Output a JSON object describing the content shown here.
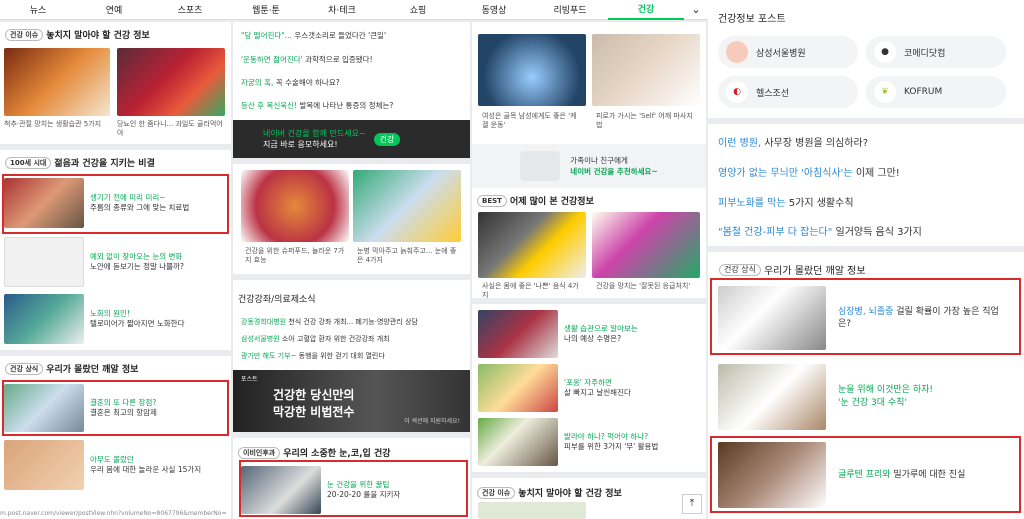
{
  "nav": [
    "뉴스",
    "연예",
    "스포츠",
    "웹툰·툰",
    "차·테크",
    "쇼핑",
    "동영상",
    "리빙푸드",
    "건강"
  ],
  "col1": {
    "s1_badge": "건강 이슈",
    "s1_title": "놓치지 말아야 할 건강 정보",
    "s1_caps": [
      "척추·관절 망치는 생활습관 5가지",
      "당뇨인 한 줌다니... 과일도 골라먹어야"
    ],
    "s2_badge": "100세 시대",
    "s2_title": "젊음과 건강을 지키는 비결",
    "s2_items": [
      {
        "l1": "생기기 전에 미리 미리~",
        "l2": "주름의 종류와 그에 맞는 치료법"
      },
      {
        "l1": "예외 없이 찾아오는 눈의 변화",
        "l2": "노안에 돋보기는 정말 나쁠까?"
      },
      {
        "l1": "노화의 원인!",
        "l2": "텔로미어가 짧아지면 노화한다"
      }
    ],
    "s3_badge": "건강 상식",
    "s3_title": "우리가 몰랐던 깨알 정보",
    "s3_items": [
      {
        "l1": "결혼의 또 다른 장점?",
        "l2": "결혼은 최고의 항암제"
      },
      {
        "l1": "아무도 몰랐던",
        "l2": "우리 몸에 대한 놀라운 사실 15가지"
      }
    ],
    "url": "m.post.naver.com/viewer/postView.nhn?volumeNo=8067796&memberNo="
  },
  "col2": {
    "links1": [
      {
        "a": "\"당 떨어진다\"...",
        "b": " 우스갯소리로 들었다간 '큰일'"
      },
      {
        "a": "'운동하면 젊어진다'",
        "b": " 과학적으로 입증됐다!"
      },
      {
        "a": "자궁의 혹,",
        "b": " 꼭 수술해야 하나요?"
      },
      {
        "a": "등산 후 목신욱신!",
        "b": " 발목에 나타난 통증의 정체는?"
      }
    ],
    "banner_l1": "네이버 건강을 함께 만드세요~",
    "banner_l2": "지금 바로 응모하세요!",
    "banner_btn": "건강",
    "caps": [
      "건강을 위한 슈퍼푸드, 놀라운 7가지 효능",
      "눈병 막아주고 늙춰주고... 눈에 좋은 4가지"
    ],
    "s2_title": "건강강좌/의료제소식",
    "links2": [
      {
        "a": "강동경희대병원",
        "b": " 천식 건강 강좌 개최... 폐기능·영양관리 상담"
      },
      {
        "a": "삼성서울병원",
        "b": " 소아 고혈압 환자 위한 건강강좌 개최"
      },
      {
        "a": "광기만 해도 기부~",
        "b": " 동행을 위한 걷기 대회 열린다"
      }
    ],
    "promo_tag": "포스트",
    "promo_l1": "건강한 당신만의",
    "promo_l2": "막강한 비법전수",
    "promo_sub": "이 섹션에 지원하세요!",
    "s3_badge": "이비인후과",
    "s3_title": "우리의 소중한 눈,코,입 건강",
    "s3_item": {
      "l1": "눈 건강을 위한 꿀팁",
      "l2": "20-20-20 룰을 지키자"
    }
  },
  "col3": {
    "caps": [
      "여성은 골목 남성에게도 좋은 '케겔 운동'",
      "피로가 가시는 'Self' 어깨 마사지 법"
    ],
    "promo_l1": "가족이나 친구에게",
    "promo_l2": "네이버 건강을 추천하세요~",
    "s2_badge": "BEST",
    "s2_title": "어제 많이 본 건강정보",
    "caps2": [
      "사실은 몸에 좋은 '나쁜' 음식 4가지",
      "건강을 망치는 '잘못된 응급처치'"
    ],
    "items": [
      {
        "l1": "생활 습관으로 알아보는",
        "l2": "나의 예상 수명은?"
      },
      {
        "l1": "'포옹' 자주하면",
        "l2": "살 빠지고 날씬해진다"
      },
      {
        "l1": "발라야 하나? 먹어야 하나?",
        "l2": "피부를 위한 3가지 '무' 활용법"
      }
    ],
    "s3_badge": "건강 이슈",
    "s3_title": "놓치지 말아야 할 건강 정보"
  },
  "col4": {
    "title": "건강정보 포스트",
    "posts": [
      "삼성서울병원",
      "코메디닷컴",
      "헬스조선",
      "KOFRUM"
    ],
    "links": [
      {
        "a": "이런 병원,",
        "b": " 사무장 병원을 의심하라?"
      },
      {
        "a": "영양가 없는 무늬만 '아침식사'는",
        "b": " 이제 그만!"
      },
      {
        "a": "피부노화를 막는",
        "b": " 5가지 생활수칙"
      },
      {
        "a": "\"봄철 건강-피부 다 잡는다\"",
        "b": " 일거양득 음식 3가지"
      }
    ],
    "s2_badge": "건강 상식",
    "s2_title": "우리가 몰랐던 깨알 정보",
    "items": [
      {
        "a": "심장병, 뇌졸중",
        "b": " 걸릴 확률이 가장 높은 직업은?"
      },
      {
        "a": "눈을 위해 이것만은 하자!",
        "b": "'눈 건강 3대 수칙'"
      },
      {
        "a": "글루텐 프리와",
        "b": " 밀가루에 대한 진실"
      }
    ]
  }
}
